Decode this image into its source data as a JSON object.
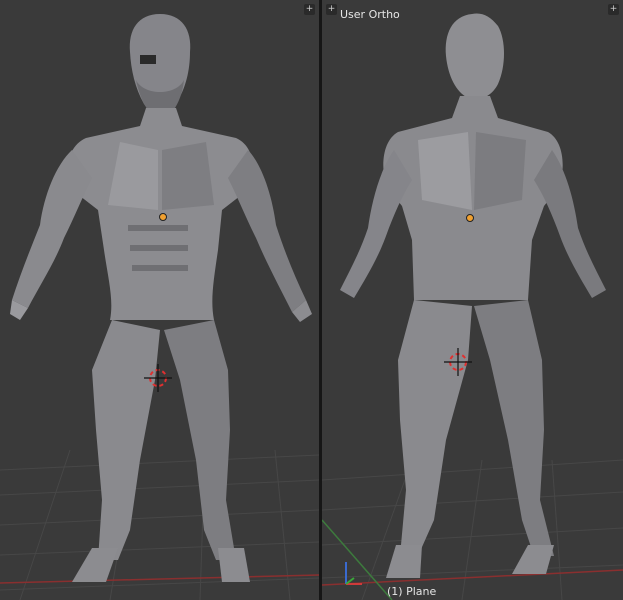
{
  "viewports": {
    "right": {
      "view_label": "User Ortho",
      "object_label": "(1) Plane"
    }
  },
  "widgets": {
    "split_handle_icon": "plus-icon"
  },
  "colors": {
    "viewport_bg": "#3a3a3a",
    "grid_line": "#474747",
    "x_axis": "#8a2f2f",
    "y_axis": "#3d7a3d",
    "mesh_base": "#8c8c90",
    "origin_dot": "#f0a030",
    "cursor_red": "#e03030"
  }
}
